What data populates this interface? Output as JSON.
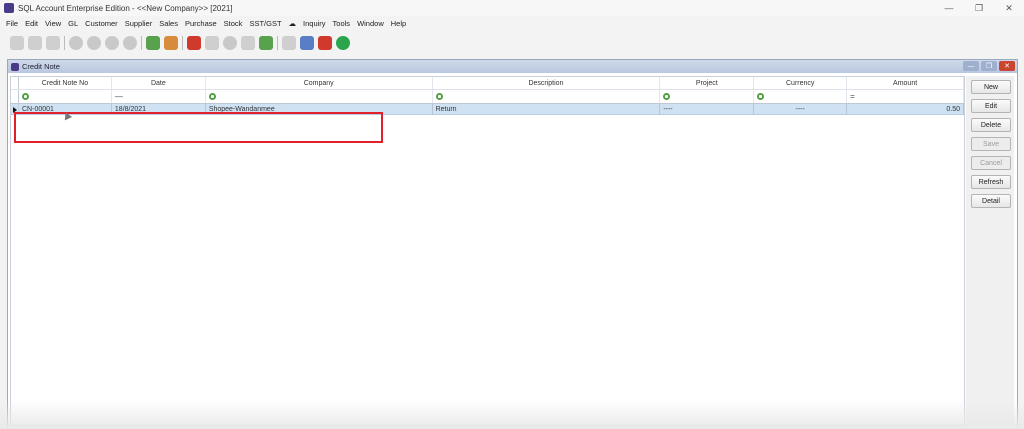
{
  "app": {
    "title": "SQL Account Enterprise Edition - <<New Company>> [2021]",
    "window_controls": {
      "minimize": "—",
      "restore": "❐",
      "close": "✕"
    }
  },
  "menu": [
    "File",
    "Edit",
    "View",
    "GL",
    "Customer",
    "Supplier",
    "Sales",
    "Purchase",
    "Stock",
    "SST/GST",
    "☁",
    "Inquiry",
    "Tools",
    "Window",
    "Help"
  ],
  "toolbar": {
    "icons": [
      "cut-icon",
      "copy-icon",
      "paste-icon",
      "nav-first-icon",
      "nav-prev-icon",
      "nav-next-icon",
      "nav-last-icon",
      "add-icon",
      "report-icon",
      "bug-icon",
      "save-icon",
      "cancel-icon",
      "find-icon",
      "refresh-icon",
      "print-icon",
      "preview-icon",
      "youtube-icon",
      "whatsapp-icon"
    ]
  },
  "child_window": {
    "title": "Credit Note",
    "controls": {
      "minimize": "—",
      "restore": "❐",
      "close": "✕"
    }
  },
  "grid": {
    "columns": [
      "Credit Note No",
      "Date",
      "Company",
      "Description",
      "Project",
      "Currency",
      "Amount"
    ],
    "filter_row": {
      "credit_note_no": "",
      "date": "—",
      "company": "",
      "description": "",
      "project": "",
      "currency": "",
      "amount": "="
    },
    "rows": [
      {
        "credit_note_no": "CN-00001",
        "date": "18/8/2021",
        "company": "Shopee-Wandanmee",
        "description": "Return",
        "project": "----",
        "currency": "----",
        "amount": "0.50"
      }
    ]
  },
  "side_buttons": {
    "new": "New",
    "edit": "Edit",
    "delete": "Delete",
    "save": "Save",
    "cancel": "Cancel",
    "refresh": "Refresh",
    "detail": "Detail"
  },
  "colors": {
    "selected_row": "#cfe2f4",
    "highlight_box": "#e0202a",
    "filter_icon": "#4f9e3f"
  }
}
